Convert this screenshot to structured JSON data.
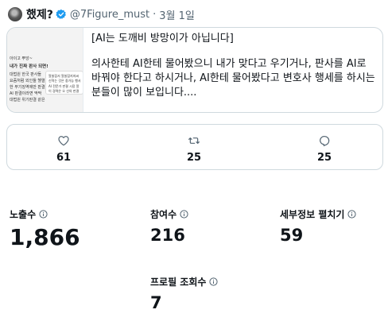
{
  "tweet": {
    "author_name": "했제?",
    "handle": "@7Figure_must",
    "separator": "·",
    "date": "3월 1일",
    "card": {
      "title": "[AI는 도깨비 방망이가 아닙니다]",
      "body": "의사한테 AI한테 물어봤으니 내가 맞다고 우기거나, 판사를 AI로 바꿔야 한다고 하시거나, AI한테 물어봤다고 변호사 행세를 하시는 분들이 많이 보입니다....",
      "thumbnail_lines": [
        "아이고 뿌앙~",
        "내가 진짜 판사 되면!",
        "대법원 한국 판사들",
        "요즘처럼 외인들 헬렬",
        "한 무기징역에만 판결",
        "AI 판결이라면 딱딱",
        "대법원 위기판결 같은"
      ],
      "thumbnail_panel_lines": [
        "알쓸잡서 알쓸잡지저씨",
        "신혁는 것은 중가능 행서",
        "AI 전문가 판결 시장 알",
        "이 경력은 오 선의 판결"
      ]
    },
    "actions": {
      "likes": "61",
      "retweets": "25",
      "replies": "25"
    }
  },
  "stats": {
    "impressions": {
      "label": "노출수",
      "value": "1,866"
    },
    "engagements": {
      "label": "참여수",
      "value": "216"
    },
    "detail_expands": {
      "label": "세부정보 펼치기",
      "value": "59"
    },
    "profile_visits": {
      "label": "프로필 조회수",
      "value": "7"
    }
  },
  "colors": {
    "text": "#0f1419",
    "secondary": "#536471",
    "border": "#cfd9de",
    "verified": "#1d9bf0"
  }
}
